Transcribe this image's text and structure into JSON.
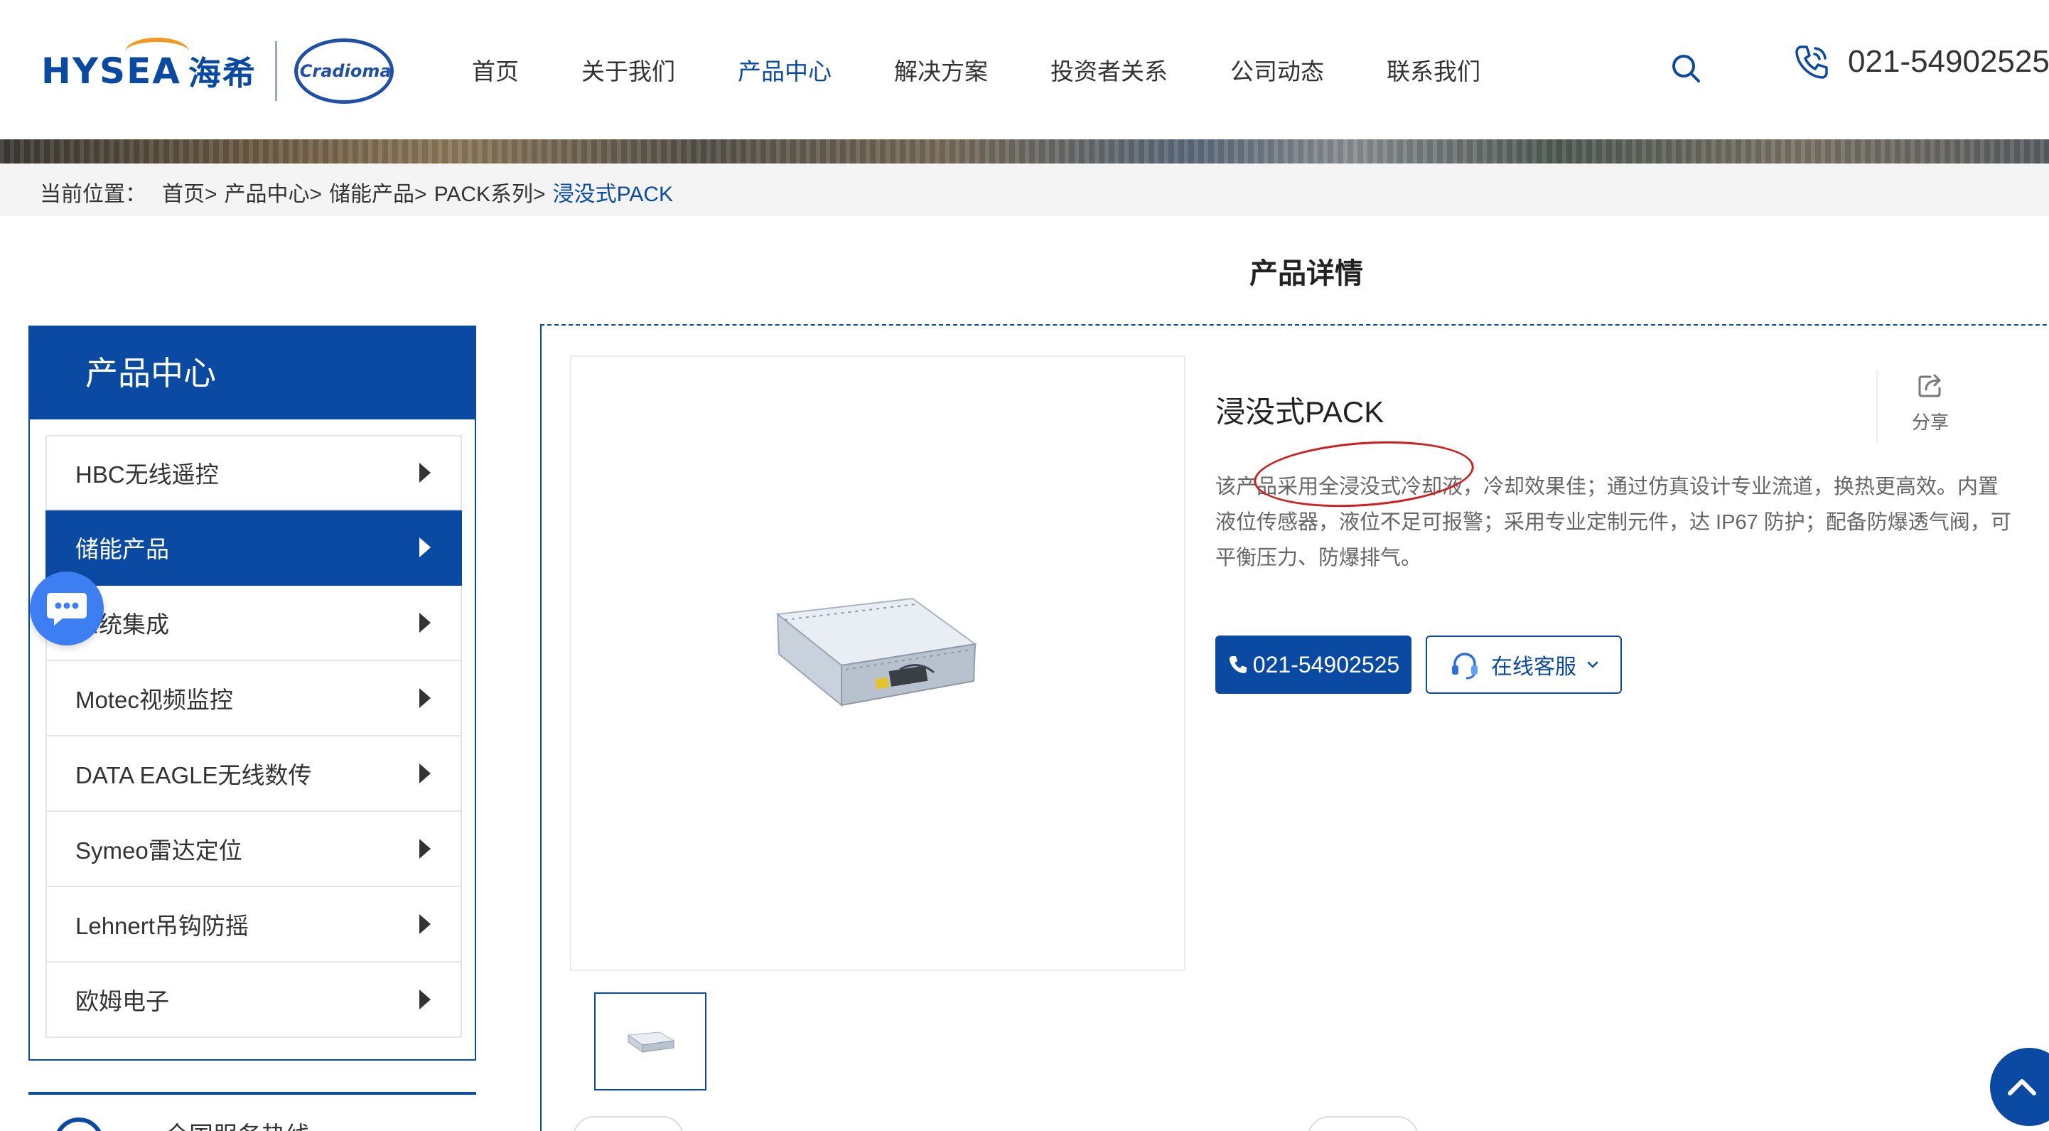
{
  "header": {
    "logo": {
      "hysea_text": "HYSEA",
      "hysea_cn": "海希",
      "hbc_text": "HBCradiomatic"
    },
    "nav": [
      "首页",
      "关于我们",
      "产品中心",
      "解决方案",
      "投资者关系",
      "公司动态",
      "联系我们"
    ],
    "active_nav": "产品中心",
    "phone": "021-54902525"
  },
  "breadcrumb": {
    "prefix": "当前位置：",
    "items": [
      "首页>",
      "产品中心>",
      "储能产品>",
      "PACK系列>"
    ],
    "current": "浸没式PACK"
  },
  "page_title": "产品详情",
  "sidebar": {
    "title": "产品中心",
    "items": [
      {
        "label": "HBC无线遥控",
        "active": false
      },
      {
        "label": "储能产品",
        "active": true
      },
      {
        "label": "系统集成",
        "active": false
      },
      {
        "label": "Motec视频监控",
        "active": false
      },
      {
        "label": "DATA EAGLE无线数传",
        "active": false
      },
      {
        "label": "Symeo雷达定位",
        "active": false
      },
      {
        "label": "Lehnert吊钩防摇",
        "active": false
      },
      {
        "label": "欧姆电子",
        "active": false
      }
    ],
    "hotline_label": "全国服务热线"
  },
  "product": {
    "title": "浸没式PACK",
    "description": "该产品采用全浸没式冷却液，冷却效果佳；通过仿真设计专业流道，换热更高效。内置液位传感器，液位不足可报警；采用专业定制元件，达 IP67 防护；配备防爆透气阀，可平衡压力、防爆排气。",
    "share_label": "分享",
    "phone_button": "021-54902525",
    "service_button": "在线客服"
  },
  "colors": {
    "brand_blue": "#0b4aa2",
    "accent_orange": "#f39a1e",
    "annotation_red": "#d01c1c",
    "chat_blue": "#3d7ff2"
  },
  "icons": [
    "search-icon",
    "phone-icon",
    "share-icon",
    "chat-icon",
    "headset-icon",
    "chevron-down-icon",
    "chevron-up-icon",
    "triangle-right-icon"
  ]
}
